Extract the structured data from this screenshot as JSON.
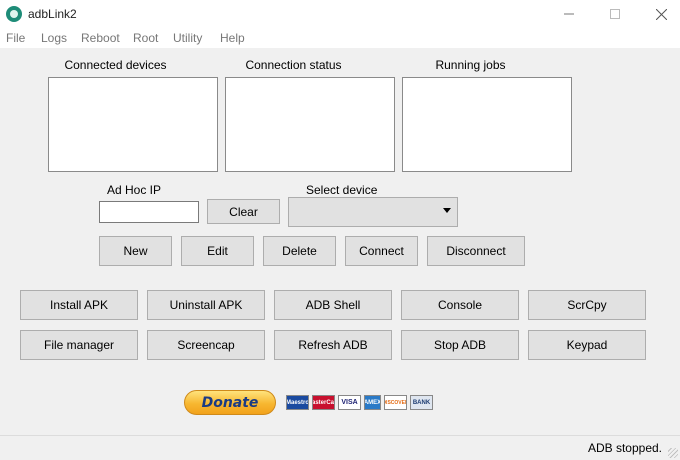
{
  "window": {
    "title": "adbLink2",
    "minimize_icon": "minimize-icon",
    "maximize_icon": "maximize-icon",
    "close_icon": "close-icon"
  },
  "menu": [
    "File",
    "Logs",
    "Reboot",
    "Root",
    "Utility",
    "Help"
  ],
  "panels": {
    "connected_devices": "Connected devices",
    "connection_status": "Connection status",
    "running_jobs": "Running jobs"
  },
  "adhoc": {
    "label": "Ad Hoc IP",
    "value": "",
    "clear_label": "Clear"
  },
  "select_device": {
    "label": "Select device",
    "value": ""
  },
  "device_buttons": [
    "New",
    "Edit",
    "Delete",
    "Connect",
    "Disconnect"
  ],
  "action_buttons_row1": [
    "Install APK",
    "Uninstall APK",
    "ADB Shell",
    "Console",
    "ScrCpy"
  ],
  "action_buttons_row2": [
    "File manager",
    "Screencap",
    "Refresh ADB",
    "Stop ADB",
    "Keypad"
  ],
  "donate": {
    "label": "Donate",
    "cards": [
      "Maestro",
      "MasterCard",
      "VISA",
      "AMEX",
      "DISCOVER",
      "BANK"
    ]
  },
  "status": "ADB stopped.",
  "colors": {
    "button_face": "#e1e1e1",
    "window_bg": "#f0f0f0",
    "donate_text": "#1b3b84"
  }
}
